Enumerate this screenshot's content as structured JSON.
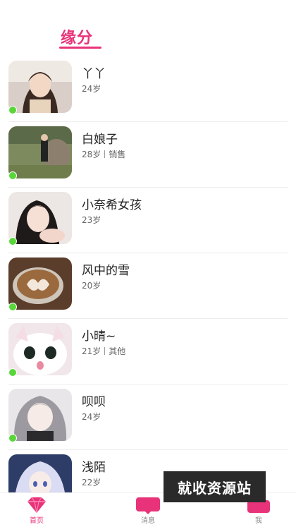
{
  "header": {
    "title": "缘分"
  },
  "users": [
    {
      "name": "丫丫",
      "age": "24岁",
      "job": "",
      "online": true,
      "photo": "girl-portrait"
    },
    {
      "name": "白娘子",
      "age": "28岁",
      "job": "销售",
      "online": true,
      "photo": "outdoor-rock"
    },
    {
      "name": "小奈希女孩",
      "age": "23岁",
      "job": "",
      "online": true,
      "photo": "girl-portrait-2"
    },
    {
      "name": "风中的雪",
      "age": "20岁",
      "job": "",
      "online": true,
      "photo": "latte-art"
    },
    {
      "name": "小晴~",
      "age": "21岁",
      "job": "其他",
      "online": true,
      "photo": "white-cat"
    },
    {
      "name": "呗呗",
      "age": "24岁",
      "job": "",
      "online": true,
      "photo": "anime-girl"
    },
    {
      "name": "浅陌",
      "age": "22岁",
      "job": "",
      "online": false,
      "photo": "anime-girl-2"
    }
  ],
  "watermark": "就收资源站",
  "tabbar": {
    "tabs": [
      {
        "label": "首页",
        "icon": "heart-diamond-icon",
        "active": true
      },
      {
        "label": "消息",
        "icon": "message-icon",
        "active": false
      },
      {
        "label": "我",
        "icon": "profile-icon",
        "active": false
      }
    ]
  },
  "colors": {
    "accent": "#e8337a",
    "online": "#58d63a"
  }
}
